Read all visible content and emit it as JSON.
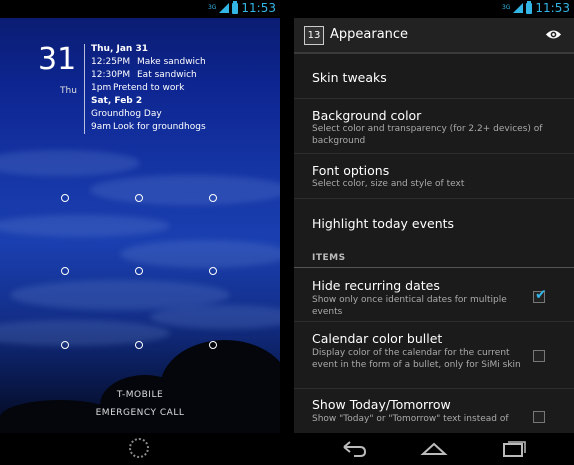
{
  "left_phone": {
    "status_bar": {
      "network": "3G",
      "time": "11:53"
    },
    "widget": {
      "day_number": "31",
      "day_name": "Thu",
      "groups": [
        {
          "date": "Thu, Jan 31",
          "events": [
            {
              "time": "12:25PM",
              "title": "Make sandwich"
            },
            {
              "time": "12:30PM",
              "title": "Eat sandwich"
            },
            {
              "time": "1pm",
              "title": "Pretend to work"
            }
          ]
        },
        {
          "date": "Sat, Feb 2",
          "events": [
            {
              "time": "",
              "title": "Groundhog Day"
            },
            {
              "time": "9am",
              "title": "Look for groundhogs"
            }
          ]
        }
      ]
    },
    "carrier": "T-MOBILE",
    "emergency_call": "EMERGENCY CALL",
    "icons": {
      "spinner": "spinner-icon"
    }
  },
  "right_phone": {
    "status_bar": {
      "network": "3G",
      "time": "11:53"
    },
    "action_bar": {
      "app_icon_label": "13",
      "title": "Appearance",
      "action_icon": "eye-icon"
    },
    "items": [
      {
        "title": "Skin tweaks",
        "summary": ""
      },
      {
        "title": "Background color",
        "summary": "Select color and transparency (for 2.2+ devices) of background"
      },
      {
        "title": "Font options",
        "summary": "Select color, size and style of text"
      },
      {
        "title": "Highlight today events",
        "summary": ""
      }
    ],
    "section_header": "ITEMS",
    "checkbox_items": [
      {
        "title": "Hide recurring dates",
        "summary": "Show only once identical dates for multiple events",
        "checked": true
      },
      {
        "title": "Calendar color bullet",
        "summary": "Display color of the calendar for the current event in the form of a bullet, only for SiMi skin",
        "checked": false
      },
      {
        "title": "Show Today/Tomorrow",
        "summary": "Show \"Today\" or \"Tomorrow\" text instead of",
        "checked": false
      }
    ],
    "navigation": [
      "back-icon",
      "home-icon",
      "recent-apps-icon"
    ],
    "colors": {
      "accent": "#33b5e5",
      "background": "#1b1b1b"
    }
  }
}
